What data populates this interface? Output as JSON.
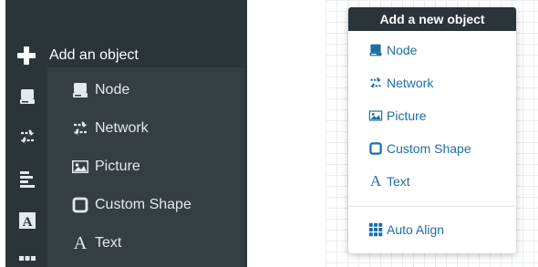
{
  "left_panel": {
    "add_label": "Add an object",
    "rail_icons": [
      "server-icon",
      "arrows-swap-icon",
      "align-left-icon",
      "text-a-icon",
      "grid-icon"
    ],
    "submenu": [
      {
        "label": "Node",
        "icon": "server-icon"
      },
      {
        "label": "Network",
        "icon": "arrows-swap-icon"
      },
      {
        "label": "Picture",
        "icon": "picture-icon"
      },
      {
        "label": "Custom Shape",
        "icon": "square-icon"
      },
      {
        "label": "Text",
        "icon": "text-a-icon",
        "glyph": "A"
      }
    ]
  },
  "dropdown": {
    "header": "Add a new object",
    "items": [
      {
        "label": "Node",
        "icon": "server-icon"
      },
      {
        "label": "Network",
        "icon": "arrows-swap-icon"
      },
      {
        "label": "Picture",
        "icon": "picture-icon"
      },
      {
        "label": "Custom Shape",
        "icon": "square-icon"
      },
      {
        "label": "Text",
        "icon": "text-a-icon",
        "glyph": "A"
      }
    ],
    "footer_item": {
      "label": "Auto Align",
      "icon": "grid-icon"
    }
  },
  "colors": {
    "dark_bg": "#2b3439",
    "submenu_bg": "#343e43",
    "link_blue": "#1d6fa5"
  }
}
